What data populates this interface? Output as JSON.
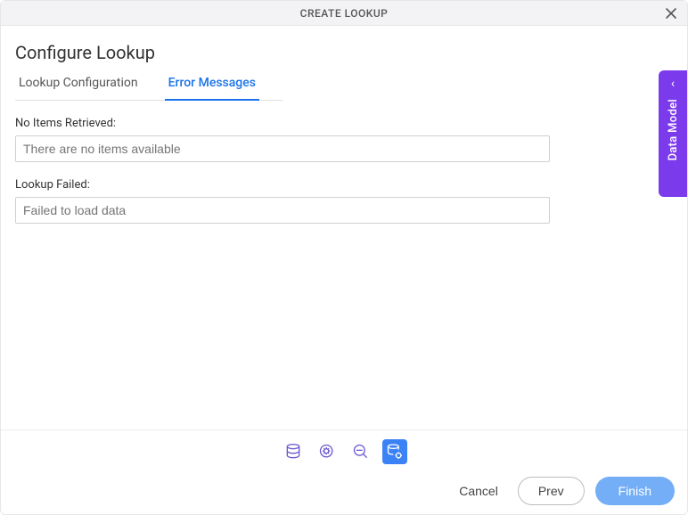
{
  "titlebar": {
    "title": "CREATE LOOKUP"
  },
  "page": {
    "heading": "Configure Lookup"
  },
  "tabs": {
    "config": "Lookup Configuration",
    "errors": "Error Messages",
    "active": "errors"
  },
  "fields": {
    "noItems": {
      "label": "No Items Retrieved:",
      "placeholder": "There are no items available",
      "value": ""
    },
    "lookupFailed": {
      "label": "Lookup Failed:",
      "placeholder": "Failed to load data",
      "value": ""
    }
  },
  "sidePanel": {
    "label": "Data Model"
  },
  "buttons": {
    "cancel": "Cancel",
    "prev": "Prev",
    "finish": "Finish"
  }
}
